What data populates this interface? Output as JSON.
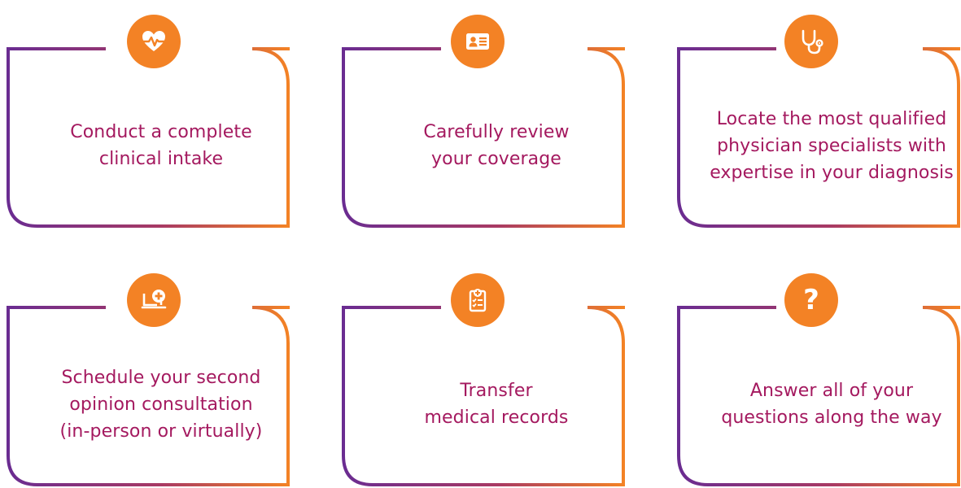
{
  "colors": {
    "text": "#a4195f",
    "icon_circle": "#f38225",
    "frame_gradient_start": "#6a2c91",
    "frame_gradient_end": "#f38225"
  },
  "cards": [
    {
      "icon": "heart-pulse-icon",
      "lines": [
        "Conduct a complete",
        "clinical intake"
      ]
    },
    {
      "icon": "id-card-icon",
      "lines": [
        "Carefully review",
        "your coverage"
      ]
    },
    {
      "icon": "stethoscope-icon",
      "lines": [
        "Locate the most qualified",
        "physician specialists with",
        "expertise in your diagnosis"
      ]
    },
    {
      "icon": "laptop-medical-icon",
      "lines": [
        "Schedule your second",
        "opinion consultation",
        "(in-person or virtually)"
      ]
    },
    {
      "icon": "clipboard-medical-icon",
      "lines": [
        "Transfer",
        "medical records"
      ]
    },
    {
      "icon": "question-icon",
      "lines": [
        "Answer all of your",
        "questions along the way"
      ],
      "glyph": "?"
    }
  ]
}
